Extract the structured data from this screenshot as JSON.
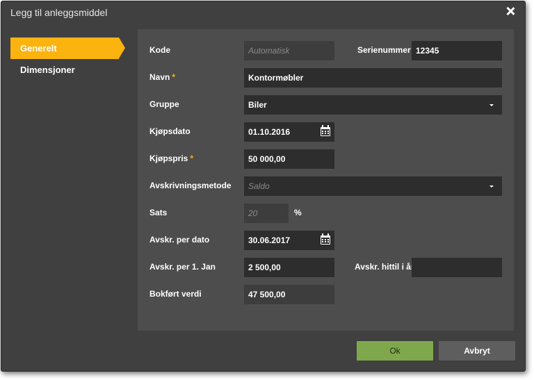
{
  "dialog": {
    "title": "Legg til anleggsmiddel"
  },
  "sidebar": {
    "items": [
      {
        "label": "Generelt",
        "active": true
      },
      {
        "label": "Dimensjoner",
        "active": false
      }
    ]
  },
  "form": {
    "kode": {
      "label": "Kode",
      "placeholder": "Automatisk",
      "value": ""
    },
    "serienummer": {
      "label": "Serienummer",
      "value": "12345"
    },
    "navn": {
      "label": "Navn",
      "required_mark": "*",
      "value": "Kontormøbler"
    },
    "gruppe": {
      "label": "Gruppe",
      "value": "Biler"
    },
    "kjopsdato": {
      "label": "Kjøpsdato",
      "value": "01.10.2016"
    },
    "kjopspris": {
      "label": "Kjøpspris",
      "required_mark": "*",
      "value": "50 000,00"
    },
    "avskrivningsmetode": {
      "label": "Avskrivningsmetode",
      "value": "Saldo"
    },
    "sats": {
      "label": "Sats",
      "placeholder": "20",
      "unit": "%"
    },
    "avskr_per_dato": {
      "label": "Avskr. per dato",
      "value": "30.06.2017"
    },
    "avskr_per_jan": {
      "label": "Avskr. per 1. Jan",
      "value": "2 500,00"
    },
    "avskr_hittil": {
      "label": "Avskr. hittil i år",
      "value": ""
    },
    "bokfort_verdi": {
      "label": "Bokført verdi",
      "value": "47 500,00"
    }
  },
  "buttons": {
    "ok": "Ok",
    "cancel": "Avbryt"
  },
  "colors": {
    "accent": "#fab30f",
    "ok_button": "#7fa84c",
    "dialog_bg": "#404040",
    "panel_bg": "#4d4d4d",
    "field_bg": "#2d2d2d"
  },
  "icons": {
    "close": "close-icon",
    "calendar": "calendar-icon",
    "dropdown": "chevron-down-icon"
  }
}
